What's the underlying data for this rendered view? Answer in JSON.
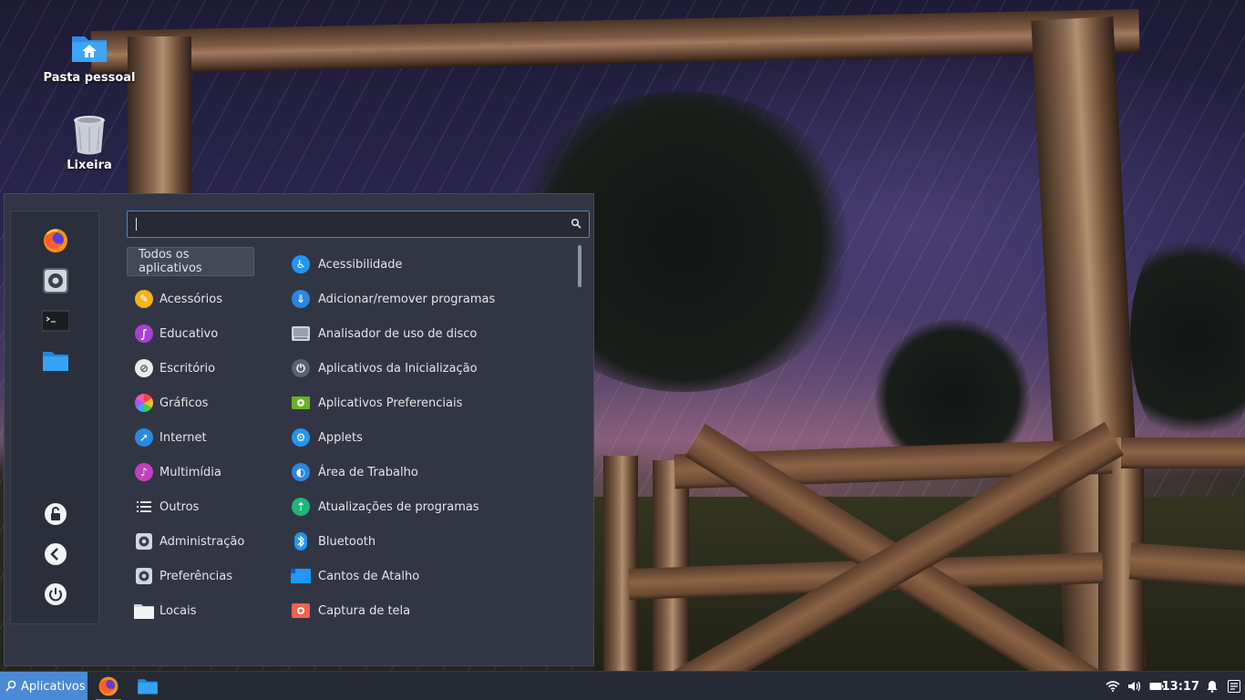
{
  "desktop": {
    "icons": [
      {
        "label": "Pasta pessoal"
      },
      {
        "label": "Lixeira"
      }
    ]
  },
  "menu": {
    "search": {
      "value": "",
      "placeholder": ""
    },
    "sidebar": {
      "favorites": [
        "firefox-icon",
        "system-settings-icon",
        "terminal-icon",
        "files-icon"
      ],
      "session": [
        "lock-icon",
        "logout-icon",
        "power-icon"
      ]
    },
    "categories": [
      {
        "label": "Todos os aplicativos"
      },
      {
        "label": "Acessórios"
      },
      {
        "label": "Educativo"
      },
      {
        "label": "Escritório"
      },
      {
        "label": "Gráficos"
      },
      {
        "label": "Internet"
      },
      {
        "label": "Multimídia"
      },
      {
        "label": "Outros"
      },
      {
        "label": "Administração"
      },
      {
        "label": "Preferências"
      },
      {
        "label": "Locais"
      }
    ],
    "apps": [
      {
        "label": "Acessibilidade"
      },
      {
        "label": "Adicionar/remover programas"
      },
      {
        "label": "Analisador de uso de disco"
      },
      {
        "label": "Aplicativos da Inicialização"
      },
      {
        "label": "Aplicativos Preferenciais"
      },
      {
        "label": "Applets"
      },
      {
        "label": "Área de Trabalho"
      },
      {
        "label": "Atualizações de programas"
      },
      {
        "label": "Bluetooth"
      },
      {
        "label": "Cantos de Atalho"
      },
      {
        "label": "Captura de tela"
      }
    ]
  },
  "taskbar": {
    "start_label": "Aplicativos",
    "clock": "13:17"
  },
  "colors": {
    "accent": "#4a8ad6",
    "menu_bg": "#323644",
    "taskbar_bg": "#262a35"
  }
}
